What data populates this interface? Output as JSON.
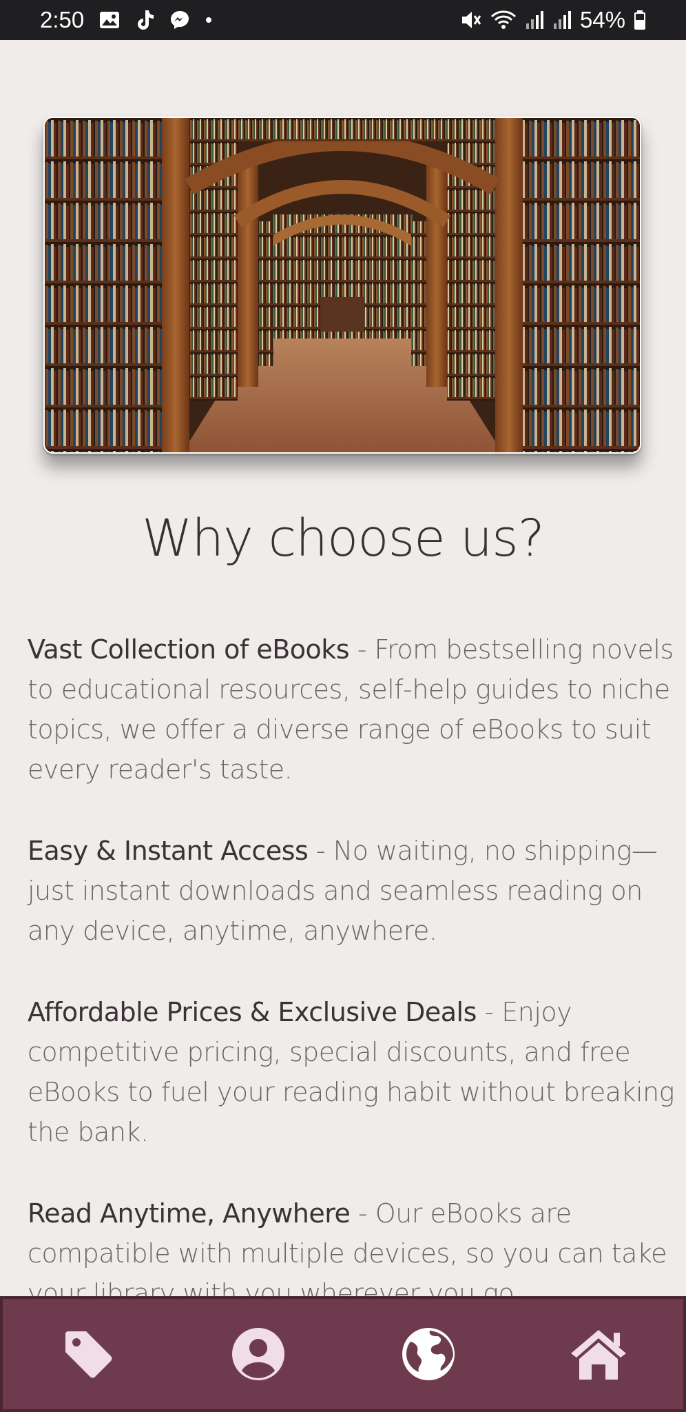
{
  "status_bar": {
    "time": "2:50",
    "battery": "54%",
    "left_icons": [
      "gallery-icon",
      "tiktok-icon",
      "messenger-icon",
      "dot-icon"
    ],
    "right_icons": [
      "mute-icon",
      "wifi-icon",
      "signal-icon",
      "signal-icon",
      "battery-icon"
    ]
  },
  "hero": {
    "image": "library-arches-photo"
  },
  "heading": "Why choose us?",
  "features": [
    {
      "title": "Vast Collection of eBooks",
      "text": " - From bestselling novels to educational resources, self-help guides to niche topics, we offer a diverse range of eBooks to suit every reader's taste."
    },
    {
      "title": "Easy & Instant Access",
      "text": " - No waiting, no shipping—just instant downloads and seamless reading on any device, anytime, anywhere."
    },
    {
      "title": "Affordable Prices & Exclusive Deals",
      "text": " - Enjoy competitive pricing, special discounts, and free eBooks to fuel your reading habit without breaking the bank."
    },
    {
      "title": "Read Anytime, Anywhere",
      "text": " - Our eBooks are compatible with multiple devices, so you can take your library with you wherever you go."
    }
  ],
  "bottom_nav": {
    "items": [
      "tag-icon",
      "user-icon",
      "globe-icon",
      "home-icon"
    ],
    "colors": {
      "background": "#6e3a4d",
      "icon": "#f0dde5",
      "active_icon": "#ffffff"
    }
  }
}
